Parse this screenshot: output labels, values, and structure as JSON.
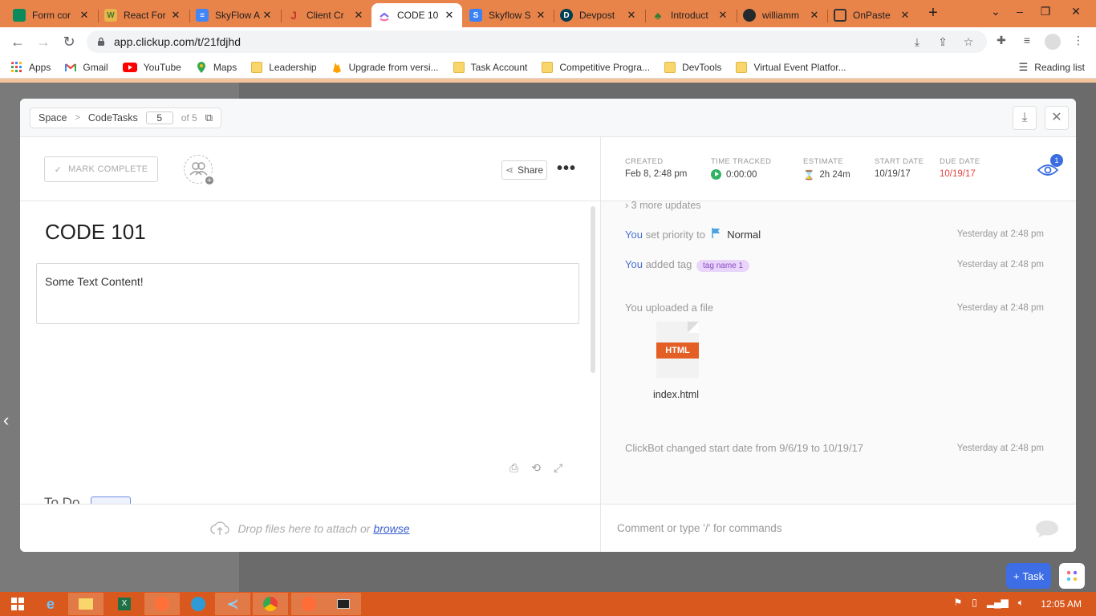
{
  "browser": {
    "tabs": [
      {
        "label": "Form cor",
        "favicon_color": "#0b8a5c",
        "glyph": ""
      },
      {
        "label": "React For",
        "favicon_color": "#3a7d2c",
        "glyph": "W"
      },
      {
        "label": "SkyFlow A",
        "favicon_color": "#4285f4",
        "glyph": "≡"
      },
      {
        "label": "Client Cr",
        "favicon_color": "#c0392b",
        "glyph": "J"
      },
      {
        "label": "CODE 10",
        "favicon_color": "#7b68ee",
        "glyph": ""
      },
      {
        "label": "Skyflow S",
        "favicon_color": "#3b82f6",
        "glyph": "S"
      },
      {
        "label": "Devpost",
        "favicon_color": "#003e54",
        "glyph": "D"
      },
      {
        "label": "Introduct",
        "favicon_color": "#2e7d32",
        "glyph": ""
      },
      {
        "label": "williamm",
        "favicon_color": "#24292e",
        "glyph": ""
      },
      {
        "label": "OnPaste",
        "favicon_color": "#555555",
        "glyph": ""
      }
    ],
    "url": "app.clickup.com/t/21fdjhd",
    "bookmarks": [
      {
        "label": "Apps",
        "kind": "apps-grid"
      },
      {
        "label": "Gmail",
        "kind": "gmail"
      },
      {
        "label": "YouTube",
        "kind": "youtube"
      },
      {
        "label": "Maps",
        "kind": "maps"
      },
      {
        "label": "Leadership",
        "kind": "folder"
      },
      {
        "label": "Upgrade from versi...",
        "kind": "firebase"
      },
      {
        "label": "Task Account",
        "kind": "folder"
      },
      {
        "label": "Competitive Progra...",
        "kind": "folder"
      },
      {
        "label": "DevTools",
        "kind": "folder"
      },
      {
        "label": "Virtual Event Platfor...",
        "kind": "folder"
      }
    ],
    "reading_list": "Reading list"
  },
  "modal": {
    "breadcrumb": {
      "space": "Space",
      "list": "CodeTasks",
      "page": "5",
      "of": "of 5"
    },
    "mark_complete": "MARK COMPLETE",
    "share": "Share",
    "title": "CODE 101",
    "description": "Some Text Content!",
    "todo_peek": "To Do",
    "drop_text": "Drop files here to attach or",
    "browse": "browse",
    "meta": {
      "created_label": "CREATED",
      "created": "Feb 8, 2:48 pm",
      "time_label": "TIME TRACKED",
      "time": "0:00:00",
      "estimate_label": "ESTIMATE",
      "estimate": "2h 24m",
      "start_label": "START DATE",
      "start": "10/19/17",
      "due_label": "DUE DATE",
      "due": "10/19/17",
      "watchers": "1"
    },
    "activity": {
      "more_updates": "3 more updates",
      "items": [
        {
          "actor": "You",
          "action": "set priority to",
          "value": "Normal",
          "time": "Yesterday at 2:48 pm"
        },
        {
          "actor": "You",
          "action": "added tag",
          "value": "tag name 1",
          "time": "Yesterday at 2:48 pm"
        },
        {
          "actor": "You",
          "action": "uploaded a file",
          "value": "",
          "time": "Yesterday at 2:48 pm"
        },
        {
          "actor": "ClickBot",
          "action": "changed start date from 9/6/19 to 10/19/17",
          "value": "",
          "time": "Yesterday at 2:48 pm"
        }
      ],
      "file": {
        "type": "HTML",
        "name": "index.html"
      }
    },
    "comment_placeholder": "Comment or type '/' for commands"
  },
  "app": {
    "task_button": "Task"
  },
  "taskbar": {
    "clock": "12:05 AM"
  }
}
